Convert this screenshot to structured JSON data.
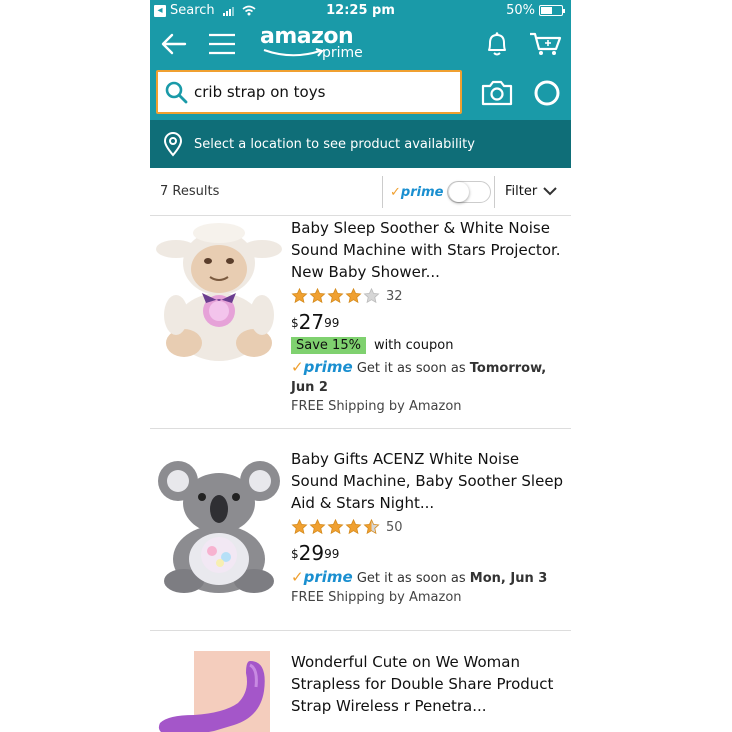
{
  "status_bar": {
    "back_app": "Search",
    "time": "12:25 pm",
    "battery": "50%"
  },
  "header": {
    "logo_word": "amazon",
    "logo_prime": "prime"
  },
  "search": {
    "query": "crib strap on toys"
  },
  "location": {
    "text": "Select a location to see product availability"
  },
  "results_bar": {
    "count": "7 Results",
    "prime_check": "✓",
    "prime_label": "prime",
    "filter_label": "Filter"
  },
  "colors": {
    "teal": "#1a9aa8",
    "dark_teal": "#0f6e78",
    "star": "#f0a030",
    "prime_blue": "#1a8fd0",
    "coupon_green": "#7fd16f"
  },
  "products": [
    {
      "title": "Baby Sleep Soother & White Noise Sound Machine with Stars Projector. New Baby Shower...",
      "rating": 4,
      "rating_count": "32",
      "price_currency": "$",
      "price_dollars": "27",
      "price_cents": "99",
      "coupon_badge": "Save 15%",
      "coupon_text": "with coupon",
      "prime_check": "✓",
      "prime_label": "prime",
      "delivery_prefix": "Get it as soon as",
      "delivery_date": "Tomorrow, Jun 2",
      "shipping": "FREE Shipping by Amazon",
      "image_icon": "lamb-plush-icon"
    },
    {
      "title": "Baby Gifts ACENZ White Noise Sound Machine, Baby Soother Sleep Aid & Stars Night...",
      "rating": 4.5,
      "rating_count": "50",
      "price_currency": "$",
      "price_dollars": "29",
      "price_cents": "99",
      "prime_check": "✓",
      "prime_label": "prime",
      "delivery_prefix": "Get it as soon as",
      "delivery_date": "Mon, Jun 3",
      "shipping": "FREE Shipping by Amazon",
      "image_icon": "koala-plush-icon"
    },
    {
      "title": "Wonderful Cute on We Woman Strapless for Double Share Product Strap Wireless r Penetra...",
      "image_icon": "purple-product-icon"
    }
  ]
}
